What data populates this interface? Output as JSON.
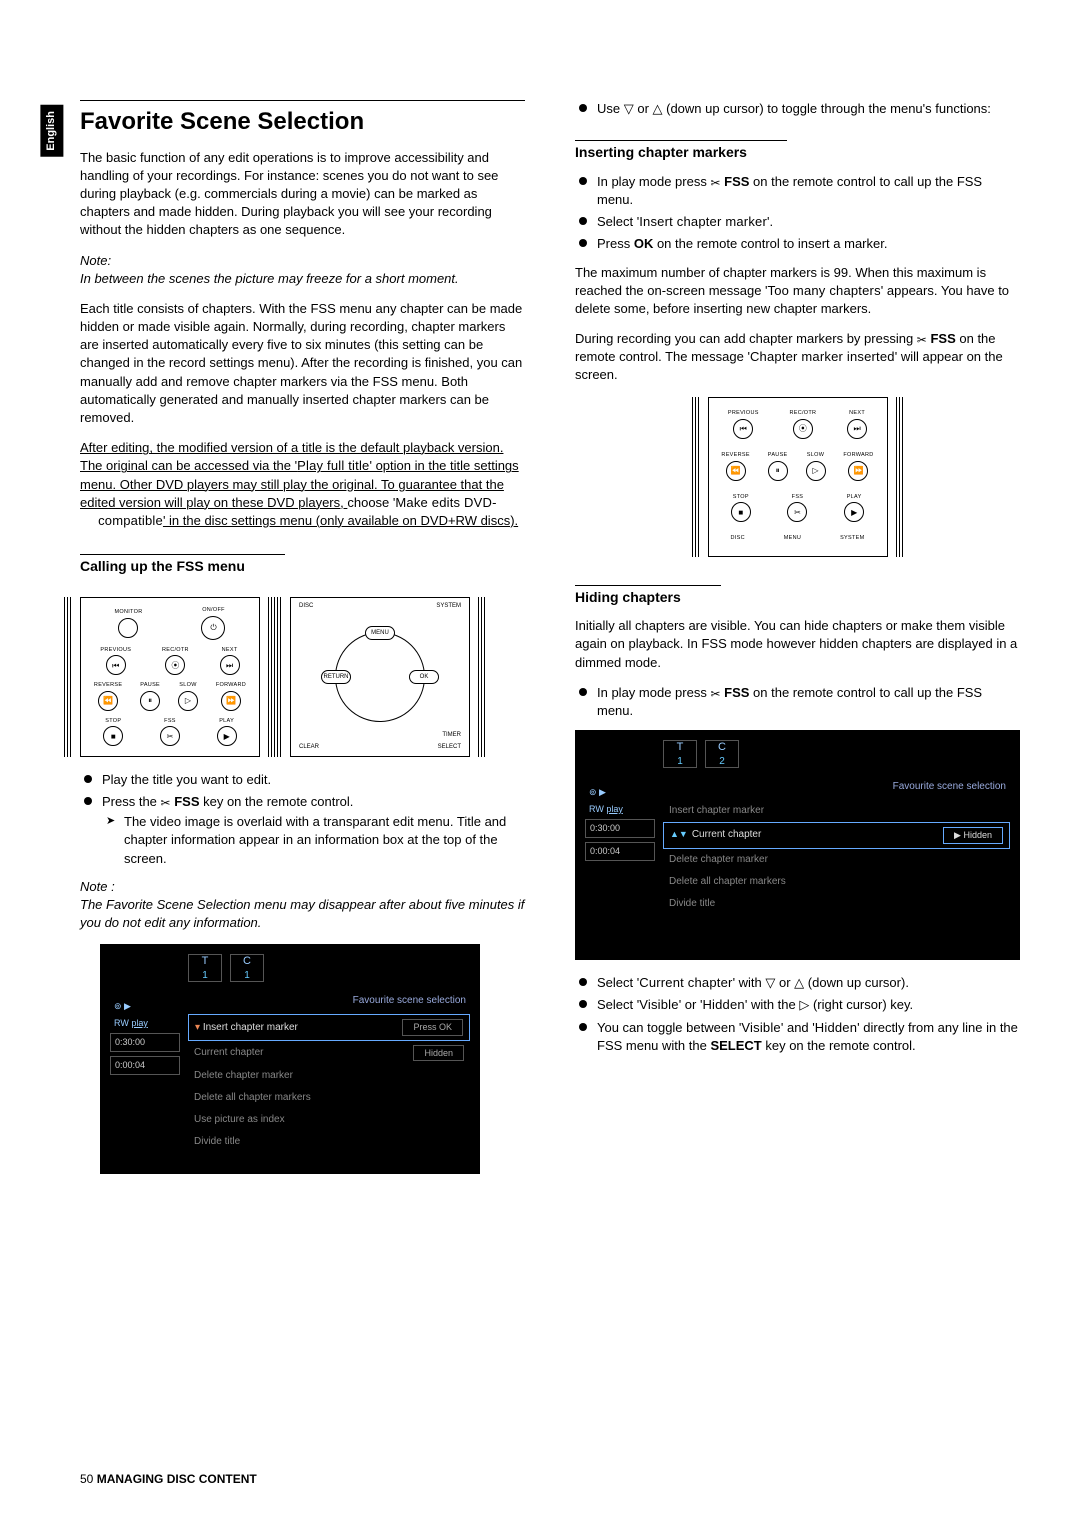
{
  "lang_tab": "English",
  "left": {
    "title": "Favorite Scene Selection",
    "p1": "The basic function of any edit operations is to improve accessibility and handling of your recordings. For instance: scenes you do not want to see during playback (e.g. commercials during a movie) can be marked as chapters and made hidden. During playback you will see your recording without the hidden chapters as one sequence.",
    "note1_label": "Note:",
    "note1_text": "In between the scenes the picture may freeze for a short moment.",
    "p2": "Each title consists of chapters. With the FSS menu any chapter can be made hidden or made visible again. Normally, during recording, chapter markers are inserted automatically every five to six minutes (this setting can be changed in the record settings menu). After the recording is finished, you can manually add and remove chapter markers via the FSS menu. Both automatically generated and manually inserted chapter markers can be removed.",
    "p3_a": "After editing, the modified version of a title is the default playback version. The original can be accessed via the '",
    "p3_term1": "Play full title",
    "p3_b": "' option in the title settings menu. Other DVD players may still play the original. To guarantee that the edited version will play on these DVD players, ",
    "p3_c": "choose '",
    "p3_term2": "Make edits DVD-",
    "p3_term3": "compatible",
    "p3_d": "' in the disc settings menu (only available on DVD+RW discs).",
    "sub1": "Calling up the FSS menu",
    "b1": "Play the title you want to edit.",
    "b2a": "Press the  ",
    "b2b": " FSS",
    "b2c": " key on the remote control.",
    "b2_sub": "The video image is overlaid with a transparant edit menu. Title and chapter information appear in an information box at the top of the screen.",
    "note2_label": "Note :",
    "note2_text": "The Favorite Scene Selection menu may disappear after about five minutes if you do not edit any information."
  },
  "right": {
    "b0a": "Use ▽ or △ (down up cursor) to toggle through the menu's functions:",
    "sub2": "Inserting chapter markers",
    "ic_b1a": "In play mode press  ",
    "ic_b1b": " FSS",
    "ic_b1c": " on the remote control to call up the FSS menu.",
    "ic_b2a": "Select '",
    "ic_b2_term": "Insert chapter marker",
    "ic_b2b": "'.",
    "ic_b3a": "Press ",
    "ic_b3b": "OK",
    "ic_b3c": " on the remote control to insert a marker.",
    "ic_p1a": "The maximum number of chapter markers is 99. When this maximum is reached the on-screen message '",
    "ic_p1_term": "Too many chapters",
    "ic_p1b": "' appears. You have to delete some, before inserting new chapter markers.",
    "ic_p2a": "During recording you can add chapter markers by pressing  ",
    "ic_p2b": " FSS",
    "ic_p2c": " on the remote control. The message '",
    "ic_p2_term": "Chapter marker inserted",
    "ic_p2d": "' will appear on the screen.",
    "sub3": "Hiding chapters",
    "hc_p1": "Initially all chapters are visible. You can hide chapters or make them visible again on playback. In FSS mode however hidden chapters are displayed in a dimmed mode.",
    "hc_b1a": "In play mode press  ",
    "hc_b1b": " FSS",
    "hc_b1c": " on the remote control to call up the FSS menu.",
    "hc_b2a": "Select '",
    "hc_b2_term": "Current chapter",
    "hc_b2b": "' with ▽ or △ (down up cursor).",
    "hc_b3a": "Select '",
    "hc_b3_term1": "Visible",
    "hc_b3b": "' or '",
    "hc_b3_term2": "Hidden",
    "hc_b3c": "' with the ▷ (right cursor) key.",
    "hc_b4a": "You can toggle between '",
    "hc_b4_term1": "Visible",
    "hc_b4b": "' and '",
    "hc_b4_term2": "Hidden",
    "hc_b4c": "' directly from any line in the FSS menu with the ",
    "hc_b4d": "SELECT",
    "hc_b4e": " key on the remote control."
  },
  "remote_labels": {
    "monitor": "MONITOR",
    "onoff": "ON/OFF",
    "previous": "PREVIOUS",
    "recotr": "REC/OTR",
    "next": "NEXT",
    "reverse": "REVERSE",
    "pause": "PAUSE",
    "slow": "SLOW",
    "forward": "FORWARD",
    "stop": "STOP",
    "fss": "FSS",
    "play": "PLAY",
    "disc": "DISC",
    "menu": "MENU",
    "system": "SYSTEM",
    "return": "RETURN",
    "ok": "OK",
    "clear": "CLEAR",
    "timer": "TIMER",
    "select": "SELECT"
  },
  "osd1": {
    "T": "T",
    "C": "C",
    "t1": "1",
    "c1": "1",
    "sideRW": "RW",
    "sidePlay": "play",
    "time1": "0:30:00",
    "time2": "0:00:04",
    "header": "Favourite scene selection",
    "rows": [
      "Insert chapter marker",
      "Current chapter",
      "Delete chapter marker",
      "Delete all chapter markers",
      "Use picture as index",
      "Divide title"
    ],
    "pressok": "Press OK",
    "hidden": "Hidden"
  },
  "osd2": {
    "T": "T",
    "C": "C",
    "t1": "1",
    "c1": "2",
    "sideRW": "RW",
    "sidePlay": "play",
    "time1": "0:30:00",
    "time2": "0:00:04",
    "header": "Favourite scene selection",
    "rows": [
      "Insert chapter marker",
      "Current chapter",
      "Delete chapter marker",
      "Delete all chapter markers",
      "Divide title"
    ],
    "hidden": "Hidden"
  },
  "footer_page": "50",
  "footer_text": "MANAGING DISC CONTENT"
}
